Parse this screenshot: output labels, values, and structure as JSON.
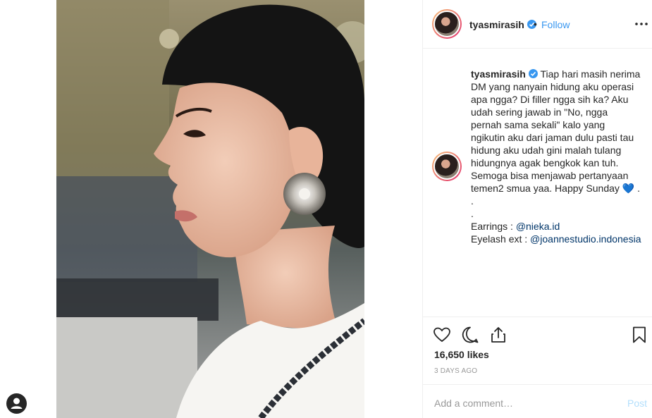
{
  "post": {
    "username": "tyasmirasih",
    "follow_label": "Follow",
    "separator": "•",
    "caption_lines": [
      "Tiap hari masih nerima",
      "DM yang nanyain hidung aku operasi",
      "apa ngga? Di filler ngga sih ka? Aku",
      "udah sering jawab in \"No, ngga",
      "pernah sama sekali\" kalo yang",
      "ngikutin aku dari jaman dulu pasti tau",
      "hidung aku udah gini malah tulang",
      "hidungnya agak bengkok kan tuh.",
      "Semoga bisa menjawab pertanyaan",
      "temen2 smua yaa. Happy Sunday"
    ],
    "heart_emoji": "💙",
    "trailing_dot": " .",
    "dot_lines": [
      ".",
      "."
    ],
    "earrings_label": "Earrings : ",
    "earrings_mention": "@nieka.id",
    "eyelash_label": "Eyelash ext : ",
    "eyelash_mention": "@joannestudio.indonesia",
    "likes": "16,650 likes",
    "date": "3 DAYS AGO"
  },
  "comment": {
    "placeholder": "Add a comment…",
    "post_label": "Post"
  },
  "icons": {
    "like": "heart-outline-icon",
    "comment": "speech-bubble-icon",
    "share": "share-upload-icon",
    "save": "bookmark-icon",
    "more": "ellipsis-icon",
    "verified": "verified-badge-icon",
    "user": "user-silhouette-icon"
  },
  "colors": {
    "accent": "#3897f0",
    "text": "#262626",
    "muted": "#999999",
    "border": "#efefef",
    "post_disabled": "#b2dffc"
  }
}
